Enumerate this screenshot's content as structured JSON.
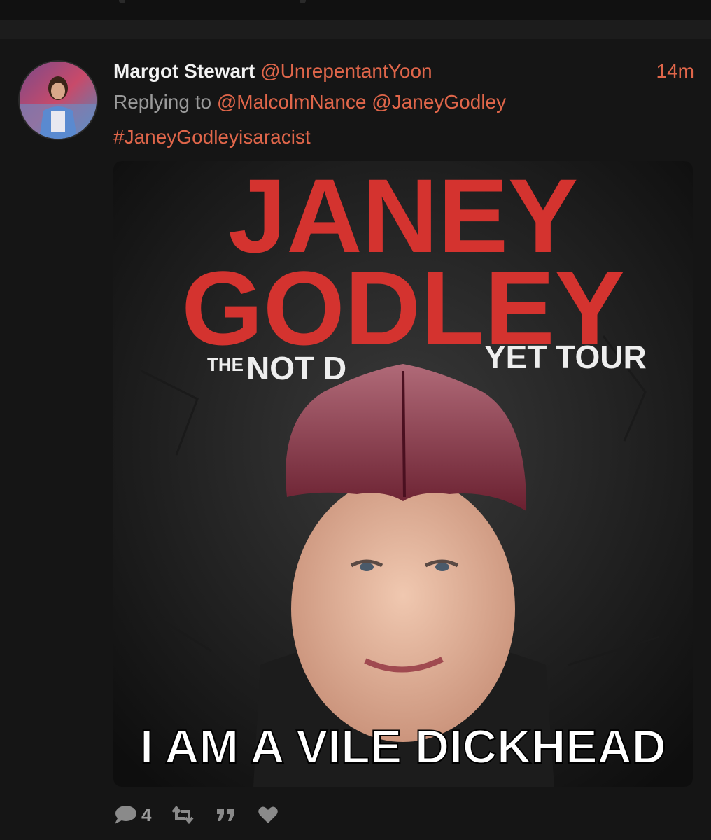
{
  "tweet": {
    "author_name": "Margot Stewart",
    "author_handle": "@UnrepentantYoon",
    "time_ago": "14m",
    "replying_prefix": "Replying to",
    "reply_mentions": [
      "@MalcolmNance",
      "@JaneyGodley"
    ],
    "hashtag": "#JaneyGodleyisaracist"
  },
  "media": {
    "poster_line1": "JANEY",
    "poster_line2": "GODLEY",
    "poster_subtitle_the": "THE",
    "poster_subtitle_left": "NOT D",
    "poster_subtitle_right": "YET TOUR",
    "caption": "I AM A VILE DICKHEAD"
  },
  "actions": {
    "reply_icon": "speech-bubble-icon",
    "reply_count": "4",
    "retweet_icon": "retweet-icon",
    "quote_icon": "quote-icon",
    "like_icon": "heart-icon"
  },
  "colors": {
    "accent": "#e0664a",
    "poster_red": "#d4332f",
    "background": "#151515"
  }
}
